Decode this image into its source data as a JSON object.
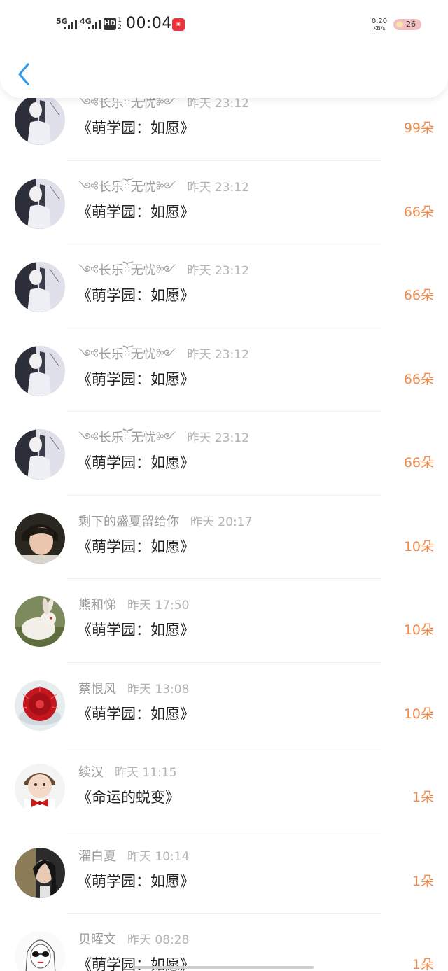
{
  "status_bar": {
    "net1": "5G",
    "net2": "4G",
    "hd_label": "HD",
    "hd_sub": "1 2",
    "time": "00:04",
    "app_badge_icon": "app-notification-icon",
    "speed_value": "0.20",
    "speed_unit": "KB/s",
    "battery": "26"
  },
  "header": {
    "back_icon": "chevron-left-icon",
    "accent_color": "#2f9bf0"
  },
  "colors": {
    "amount": "#f08a4b",
    "title": "#222222",
    "meta": "#9a9a9a"
  },
  "records": [
    {
      "user": "༺长乐ོ无忧༻",
      "time": "昨天 23:12",
      "book": "《萌学园：如愿》",
      "amount": "99朵",
      "avatar": "avatar-ink-lady"
    },
    {
      "user": "༺长乐ོ无忧༻",
      "time": "昨天 23:12",
      "book": "《萌学园：如愿》",
      "amount": "66朵",
      "avatar": "avatar-ink-lady"
    },
    {
      "user": "༺长乐ོ无忧༻",
      "time": "昨天 23:12",
      "book": "《萌学园：如愿》",
      "amount": "66朵",
      "avatar": "avatar-ink-lady"
    },
    {
      "user": "༺长乐ོ无忧༻",
      "time": "昨天 23:12",
      "book": "《萌学园：如愿》",
      "amount": "66朵",
      "avatar": "avatar-ink-lady"
    },
    {
      "user": "༺长乐ོ无忧༻",
      "time": "昨天 23:12",
      "book": "《萌学园：如愿》",
      "amount": "66朵",
      "avatar": "avatar-ink-lady"
    },
    {
      "user": "剩下的盛夏留给你",
      "time": "昨天 20:17",
      "book": "《萌学园：如愿》",
      "amount": "10朵",
      "avatar": "avatar-boy-portrait"
    },
    {
      "user": "熊和悌",
      "time": "昨天 17:50",
      "book": "《萌学园：如愿》",
      "amount": "10朵",
      "avatar": "avatar-rabbit"
    },
    {
      "user": "蔡恨风",
      "time": "昨天 13:08",
      "book": "《萌学园：如愿》",
      "amount": "10朵",
      "avatar": "avatar-red-cactus"
    },
    {
      "user": "续汉",
      "time": "昨天 11:15",
      "book": "《命运的蜕变》",
      "amount": "1朵",
      "avatar": "avatar-child-bowtie"
    },
    {
      "user": "濯白夏",
      "time": "昨天 10:14",
      "book": "《萌学园：如愿》",
      "amount": "1朵",
      "avatar": "avatar-girl-portrait"
    },
    {
      "user": "贝曜文",
      "time": "昨天 08:28",
      "book": "《萌学园：如愿》",
      "amount": "1朵",
      "avatar": "avatar-sketch-sunglasses"
    }
  ]
}
